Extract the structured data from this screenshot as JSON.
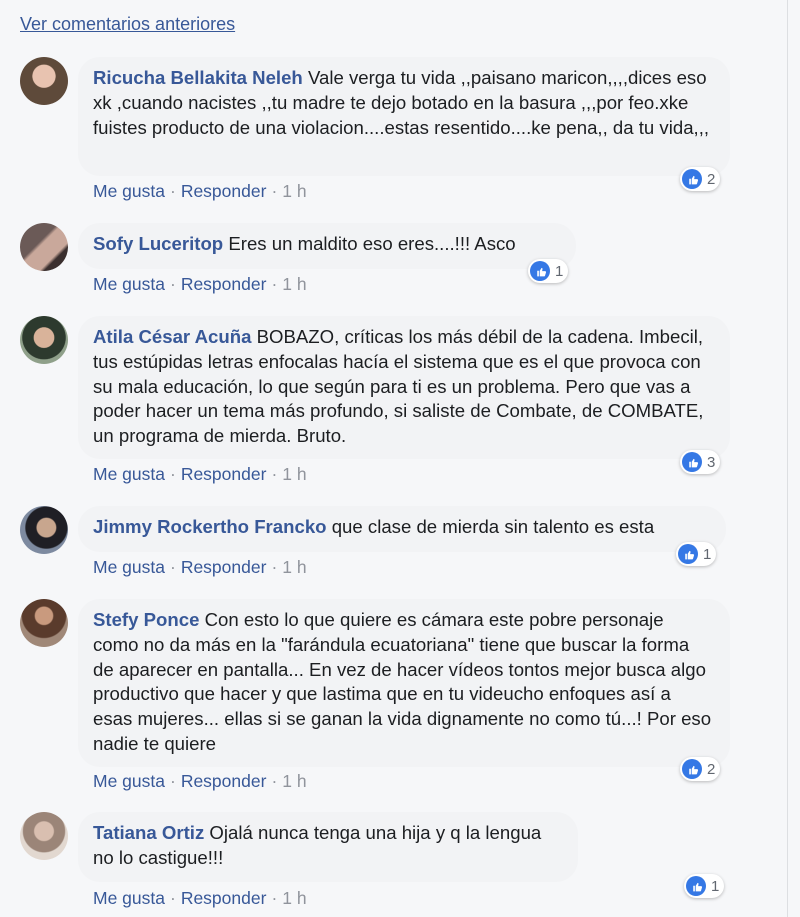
{
  "more_comments_link": "Ver comentarios anteriores",
  "actions": {
    "like": "Me gusta",
    "reply": "Responder",
    "separator": "·"
  },
  "colors": {
    "link": "#385898",
    "bubble": "#f2f3f5",
    "like_badge": "#3578e5",
    "page_bg": "#f6f7f9"
  },
  "icons": {
    "reaction": "like-thumb-icon"
  },
  "comments": [
    {
      "author": "Ricucha Bellakita Neleh",
      "text": "Vale verga tu vida ,,paisano maricon,,,,dices eso xk ,cuando nacistes ,,tu madre te dejo botado en la basura ,,,por feo.xke fuistes producto de una violacion....estas resentido....ke pena,, da tu vida,,,",
      "time": "1 h",
      "reactions": "2"
    },
    {
      "author": "Sofy Luceritop",
      "text": "Eres un maldito eso eres....!!! Asco",
      "time": "1 h",
      "reactions": "1"
    },
    {
      "author": "Atila César Acuña",
      "text": "BOBAZO, críticas los más débil de la cadena. Imbecil, tus estúpidas letras enfocalas hacía el sistema que es el que provoca con su mala educación, lo que según para ti es un problema. Pero que vas a poder hacer un tema más profundo, si saliste de Combate, de COMBATE, un programa de mierda. Bruto.",
      "time": "1 h",
      "reactions": "3"
    },
    {
      "author": "Jimmy Rockertho Francko",
      "text": "que clase de mierda sin talento es esta",
      "time": "1 h",
      "reactions": "1"
    },
    {
      "author": "Stefy Ponce",
      "text": "Con esto lo que quiere es cámara este pobre personaje como no da más en la \"farándula ecuatoriana\" tiene que buscar la forma de aparecer en pantalla... En vez de hacer vídeos tontos mejor busca algo productivo que hacer y que lastima que en tu videucho enfoques así a esas mujeres... ellas si se ganan la vida dignamente no como tú...! Por eso nadie te quiere",
      "time": "1 h",
      "reactions": "2"
    },
    {
      "author": "Tatiana Ortiz",
      "text": "Ojalá nunca tenga una hija y q la lengua no lo castigue!!!",
      "time": "1 h",
      "reactions": "1"
    }
  ]
}
